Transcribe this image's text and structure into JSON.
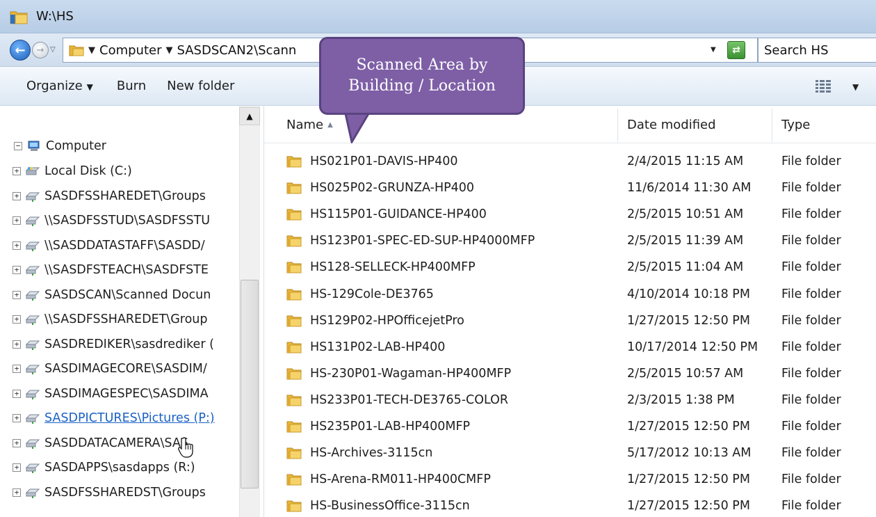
{
  "window": {
    "title": "W:\\HS"
  },
  "address_bar": {
    "crumbs": [
      "Computer",
      "SASDSCAN2\\Scann"
    ],
    "search_placeholder": "Search HS"
  },
  "toolbar": {
    "organize_label": "Organize",
    "burn_label": "Burn",
    "new_folder_label": "New folder"
  },
  "callout": {
    "line1": "Scanned Area by",
    "line2": "Building / Location"
  },
  "nav_tree": {
    "root": "Computer",
    "items": [
      {
        "label": "Local Disk (C:)",
        "icon": "local-disk-icon"
      },
      {
        "label": "SASDFSSHAREDET\\Groups",
        "icon": "network-drive-icon"
      },
      {
        "label": "\\\\SASDFSSTUD\\SASDFSSTU",
        "icon": "network-drive-icon"
      },
      {
        "label": "\\\\SASDDATASTAFF\\SASDD/",
        "icon": "network-drive-icon"
      },
      {
        "label": "\\\\SASDFSTEACH\\SASDFSTE",
        "icon": "network-drive-icon"
      },
      {
        "label": "SASDSCAN\\Scanned Docun",
        "icon": "network-drive-icon"
      },
      {
        "label": "\\\\SASDFSSHAREDET\\Group",
        "icon": "network-drive-icon"
      },
      {
        "label": "SASDREDIKER\\sasdrediker (",
        "icon": "network-drive-icon"
      },
      {
        "label": "SASDIMAGECORE\\SASDIM/",
        "icon": "network-drive-icon"
      },
      {
        "label": "SASDIMAGESPEC\\SASDIMA",
        "icon": "network-drive-icon"
      },
      {
        "label": "SASDPICTURES\\Pictures (P:)",
        "icon": "network-drive-icon",
        "hovered": true
      },
      {
        "label": "SASDDATACAMERA\\SAS",
        "icon": "network-drive-icon"
      },
      {
        "label": "SASDAPPS\\sasdapps (R:)",
        "icon": "network-drive-icon"
      },
      {
        "label": "SASDFSSHAREDST\\Groups",
        "icon": "network-drive-icon"
      }
    ]
  },
  "file_list": {
    "columns": {
      "name": "Name",
      "date": "Date modified",
      "type": "Type"
    },
    "rows": [
      {
        "name": "HS021P01-DAVIS-HP400",
        "date": "2/4/2015 11:15 AM",
        "type": "File folder"
      },
      {
        "name": "HS025P02-GRUNZA-HP400",
        "date": "11/6/2014 11:30 AM",
        "type": "File folder"
      },
      {
        "name": "HS115P01-GUIDANCE-HP400",
        "date": "2/5/2015 10:51 AM",
        "type": "File folder"
      },
      {
        "name": "HS123P01-SPEC-ED-SUP-HP4000MFP",
        "date": "2/5/2015 11:39 AM",
        "type": "File folder"
      },
      {
        "name": "HS128-SELLECK-HP400MFP",
        "date": "2/5/2015 11:04 AM",
        "type": "File folder"
      },
      {
        "name": "HS-129Cole-DE3765",
        "date": "4/10/2014 10:18 PM",
        "type": "File folder"
      },
      {
        "name": "HS129P02-HPOfficejetPro",
        "date": "1/27/2015 12:50 PM",
        "type": "File folder"
      },
      {
        "name": "HS131P02-LAB-HP400",
        "date": "10/17/2014 12:50 PM",
        "type": "File folder"
      },
      {
        "name": "HS-230P01-Wagaman-HP400MFP",
        "date": "2/5/2015 10:57 AM",
        "type": "File folder"
      },
      {
        "name": "HS233P01-TECH-DE3765-COLOR",
        "date": "2/3/2015 1:38 PM",
        "type": "File folder"
      },
      {
        "name": "HS235P01-LAB-HP400MFP",
        "date": "1/27/2015 12:50 PM",
        "type": "File folder"
      },
      {
        "name": "HS-Archives-3115cn",
        "date": "5/17/2012 10:13 AM",
        "type": "File folder"
      },
      {
        "name": "HS-Arena-RM011-HP400CMFP",
        "date": "1/27/2015 12:50 PM",
        "type": "File folder"
      },
      {
        "name": "HS-BusinessOffice-3115cn",
        "date": "1/27/2015 12:50 PM",
        "type": "File folder"
      }
    ]
  },
  "colors": {
    "callout_fill": "#7e5fa6",
    "link_hover": "#1a61c4",
    "folder_yellow": "#f2c94c"
  }
}
